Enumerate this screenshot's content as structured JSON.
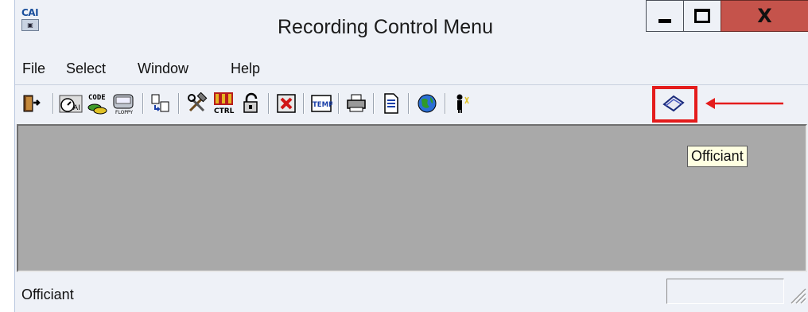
{
  "window": {
    "title": "Recording Control Menu",
    "app_icon_text": "CAI",
    "controls": {
      "minimize": "minimize",
      "maximize": "maximize",
      "close": "X"
    }
  },
  "menu": {
    "items": [
      "File",
      "Select",
      "Window",
      "Help"
    ]
  },
  "toolbar": {
    "icons": [
      "exit-door-icon",
      "timer-gauge-icon",
      "code-icon",
      "floppy-icon",
      "copy-icon",
      "tools-icon",
      "control-icon",
      "padlock-icon",
      "delete-icon",
      "temp-icon",
      "printer-icon",
      "document-icon",
      "globe-icon",
      "person-icon",
      "officiant-book-icon"
    ],
    "highlighted_icon": "officiant-book-icon"
  },
  "tooltip": {
    "text": "Officiant"
  },
  "status": {
    "text": "Officiant"
  },
  "colors": {
    "highlight": "#e41c1c",
    "close_button": "#c5534b",
    "content_bg": "#a9a9a9",
    "tooltip_bg": "#ffffe1"
  }
}
